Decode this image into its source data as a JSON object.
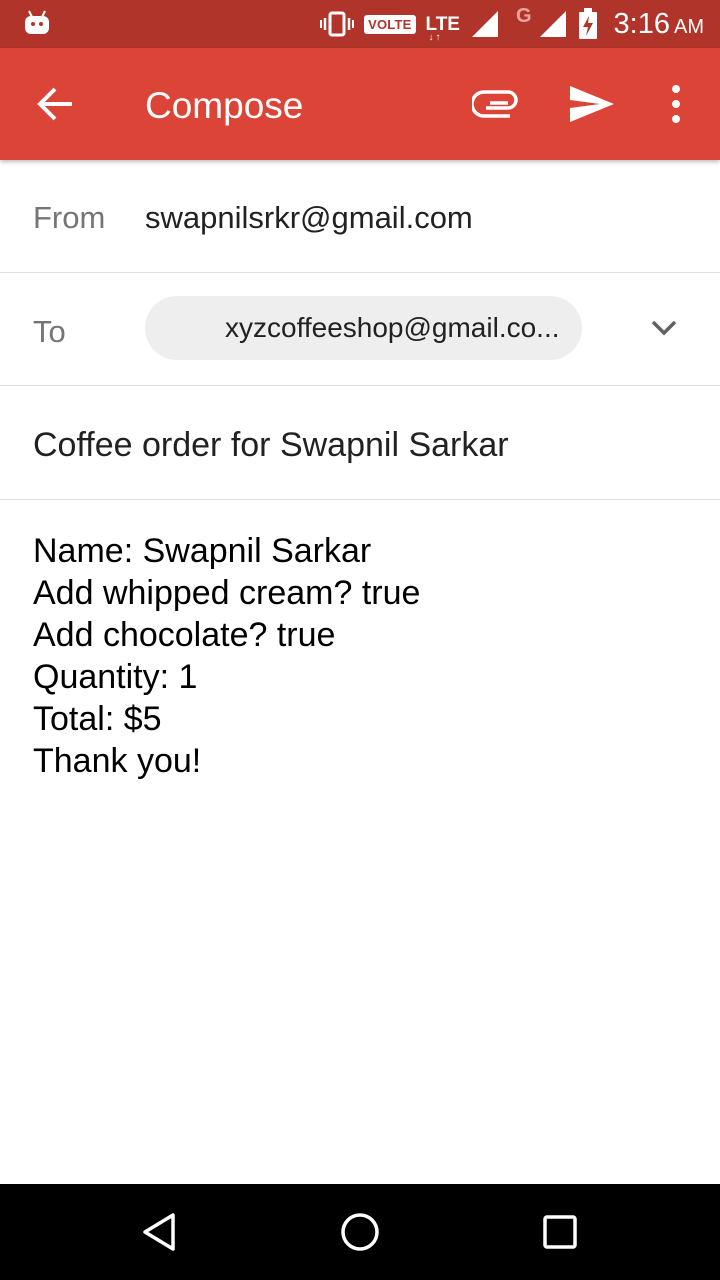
{
  "status_bar": {
    "network_label": "VOLTE",
    "lte_label": "LTE",
    "lte_arrows": "↓↑",
    "g_label": "G",
    "time": "3:16",
    "ampm": "AM"
  },
  "app_bar": {
    "title": "Compose",
    "color": "#db4437"
  },
  "compose": {
    "from_label": "From",
    "from_value": "swapnilsrkr@gmail.com",
    "to_label": "To",
    "to_chip": "xyzcoffeeshop@gmail.co...",
    "subject": "Coffee order for Swapnil Sarkar",
    "body": {
      "line1": "Name: Swapnil Sarkar",
      "line2": "Add whipped cream? true",
      "line3": "Add chocolate? true",
      "line4": "Quantity: 1",
      "line5": "Total: $5",
      "line6": "Thank you!"
    }
  },
  "icons": {
    "back": "arrow-back-icon",
    "attach": "paperclip-icon",
    "send": "send-icon",
    "more": "more-vert-icon",
    "expand": "chevron-down-icon",
    "nav": [
      "nav-back-icon",
      "nav-home-icon",
      "nav-recents-icon"
    ]
  }
}
